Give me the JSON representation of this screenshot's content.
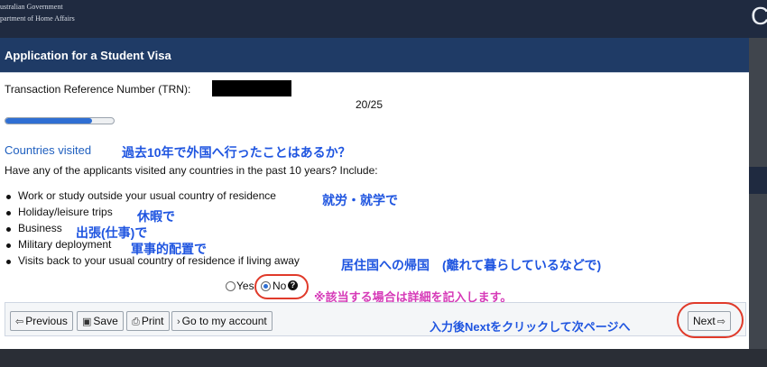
{
  "header": {
    "gov_line1": "ustralian Government",
    "gov_line2": "partment of Home Affairs",
    "right_letter": "C"
  },
  "panel": {
    "title": "Application for a Student Visa"
  },
  "trn": {
    "label": "Transaction Reference Number (TRN):"
  },
  "progress": {
    "text": "20/25",
    "fraction": 0.8
  },
  "section": {
    "title": "Countries visited",
    "annotation": "過去10年で外国へ行ったことはあるか？",
    "question": "Have any of the applicants visited any countries in the past 10 years? Include:"
  },
  "list_items": [
    {
      "label": "Work or study outside your usual country of residence",
      "annotation": "就労・就学で"
    },
    {
      "label": "Holiday/leisure trips",
      "annotation": "休暇で"
    },
    {
      "label": "Business",
      "annotation": "出張(仕事)で"
    },
    {
      "label": "Military deployment",
      "annotation": "軍事的配置で"
    },
    {
      "label": "Visits back to your usual country of residence if living away",
      "annotation": "居住国への帰国　(離れて暮らしているなどで)"
    }
  ],
  "radio": {
    "yes_label": "Yes",
    "no_label": "No",
    "selected": "No",
    "help_glyph": "?"
  },
  "note_pink": "※該当する場合は詳細を記入します。",
  "buttons": {
    "previous": "Previous",
    "save": "Save",
    "print": "Print",
    "account": "Go to my account",
    "next": "Next"
  },
  "note_next": "入力後Nextをクリックして次ページへ",
  "colors": {
    "header": "#1f2a40",
    "titlebar": "#1f3b66",
    "accent_blue": "#1f55e0",
    "annotation_red": "#e03a2a",
    "annotation_pink": "#d63ab8"
  }
}
